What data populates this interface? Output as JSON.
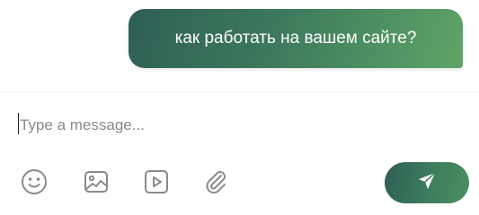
{
  "message": {
    "text": "как работать на вашем сайте?"
  },
  "composer": {
    "placeholder": "Type a message..."
  },
  "toolbar": {
    "icons": [
      "emoji-icon",
      "image-icon",
      "video-icon",
      "attachment-icon"
    ],
    "send_icon": "send-icon"
  },
  "colors": {
    "accent_start": "#2f5f55",
    "accent_end": "#5fa467",
    "icon_gray": "#8a8a8a"
  }
}
